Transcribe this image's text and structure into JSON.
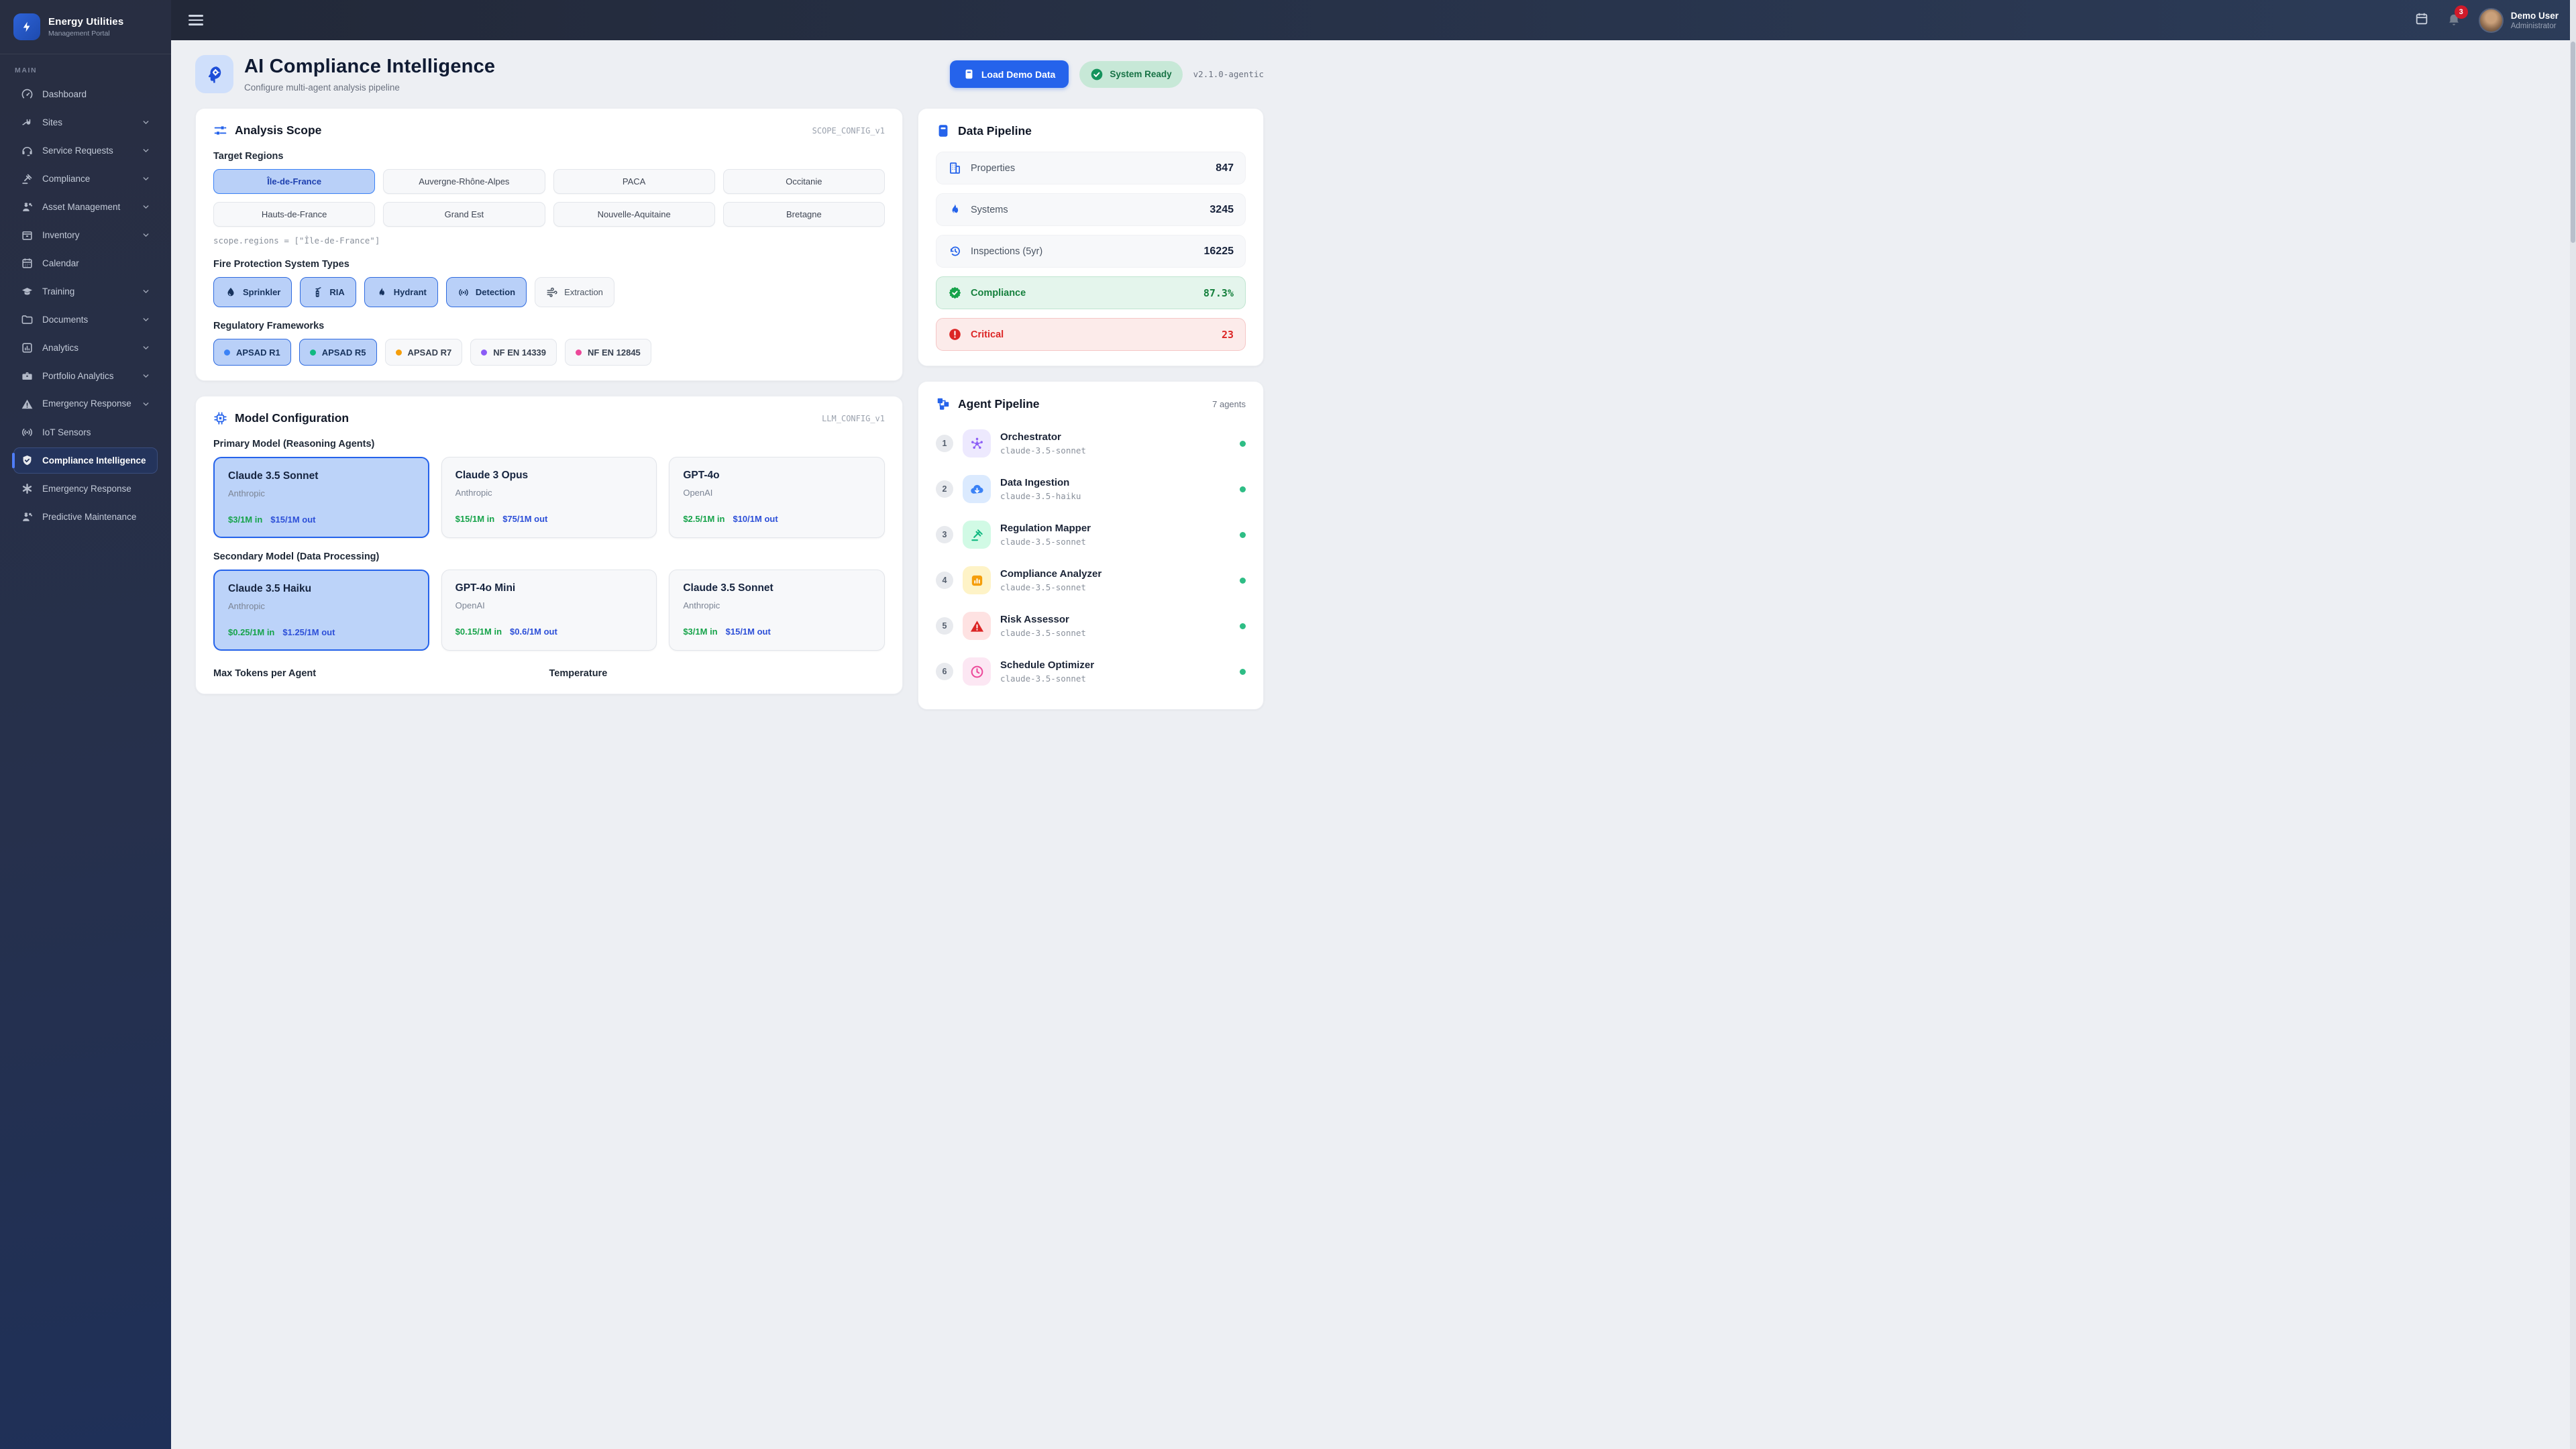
{
  "app": {
    "name": "Energy Utilities",
    "subtitle": "Management Portal"
  },
  "topbar": {
    "user_name": "Demo User",
    "user_role": "Administrator",
    "notification_count": "3"
  },
  "sidebar": {
    "section_label": "MAIN",
    "items": [
      {
        "label": "Dashboard"
      },
      {
        "label": "Sites"
      },
      {
        "label": "Service Requests"
      },
      {
        "label": "Compliance"
      },
      {
        "label": "Asset Management"
      },
      {
        "label": "Inventory"
      },
      {
        "label": "Calendar"
      },
      {
        "label": "Training"
      },
      {
        "label": "Documents"
      },
      {
        "label": "Analytics"
      },
      {
        "label": "Portfolio Analytics"
      },
      {
        "label": "Emergency Response"
      },
      {
        "label": "IoT Sensors"
      },
      {
        "label": "Compliance Intelligence"
      },
      {
        "label": "Emergency Response"
      },
      {
        "label": "Predictive Maintenance"
      }
    ]
  },
  "header": {
    "title": "AI Compliance Intelligence",
    "subtitle": "Configure multi-agent analysis pipeline",
    "load_demo_label": "Load Demo Data",
    "status_label": "System Ready",
    "version": "v2.1.0-agentic"
  },
  "analysis_scope": {
    "title": "Analysis Scope",
    "config_tag": "SCOPE_CONFIG_v1",
    "regions_label": "Target Regions",
    "regions": [
      {
        "name": "Île-de-France"
      },
      {
        "name": "Auvergne-Rhône-Alpes"
      },
      {
        "name": "PACA"
      },
      {
        "name": "Occitanie"
      },
      {
        "name": "Hauts-de-France"
      },
      {
        "name": "Grand Est"
      },
      {
        "name": "Nouvelle-Aquitaine"
      },
      {
        "name": "Bretagne"
      }
    ],
    "code_line": "scope.regions = [\"Île-de-France\"]",
    "systems_label": "Fire Protection System Types",
    "systems": [
      {
        "label": "Sprinkler"
      },
      {
        "label": "RIA"
      },
      {
        "label": "Hydrant"
      },
      {
        "label": "Detection"
      },
      {
        "label": "Extraction"
      }
    ],
    "frameworks_label": "Regulatory Frameworks",
    "frameworks": [
      {
        "label": "APSAD R1",
        "dot_color": "#3b82f6"
      },
      {
        "label": "APSAD R5",
        "dot_color": "#10b981"
      },
      {
        "label": "APSAD R7",
        "dot_color": "#f59e0b"
      },
      {
        "label": "NF EN 14339",
        "dot_color": "#8b5cf6"
      },
      {
        "label": "NF EN 12845",
        "dot_color": "#ec4899"
      }
    ]
  },
  "model_config": {
    "title": "Model Configuration",
    "config_tag": "LLM_CONFIG_v1",
    "primary_label": "Primary Model (Reasoning Agents)",
    "secondary_label": "Secondary Model (Data Processing)",
    "primary": [
      {
        "name": "Claude 3.5 Sonnet",
        "provider": "Anthropic",
        "price_in": "$3/1M in",
        "price_out": "$15/1M out"
      },
      {
        "name": "Claude 3 Opus",
        "provider": "Anthropic",
        "price_in": "$15/1M in",
        "price_out": "$75/1M out"
      },
      {
        "name": "GPT-4o",
        "provider": "OpenAI",
        "price_in": "$2.5/1M in",
        "price_out": "$10/1M out"
      }
    ],
    "secondary": [
      {
        "name": "Claude 3.5 Haiku",
        "provider": "Anthropic",
        "price_in": "$0.25/1M in",
        "price_out": "$1.25/1M out"
      },
      {
        "name": "GPT-4o Mini",
        "provider": "OpenAI",
        "price_in": "$0.15/1M in",
        "price_out": "$0.6/1M out"
      },
      {
        "name": "Claude 3.5 Sonnet",
        "provider": "Anthropic",
        "price_in": "$3/1M in",
        "price_out": "$15/1M out"
      }
    ],
    "max_tokens_label": "Max Tokens per Agent",
    "temperature_label": "Temperature"
  },
  "data_pipeline": {
    "title": "Data Pipeline",
    "rows": [
      {
        "label": "Properties",
        "value": "847"
      },
      {
        "label": "Systems",
        "value": "3245"
      },
      {
        "label": "Inspections (5yr)",
        "value": "16225"
      },
      {
        "label": "Compliance",
        "value": "87.3%"
      },
      {
        "label": "Critical",
        "value": "23"
      }
    ]
  },
  "agent_pipeline": {
    "title": "Agent Pipeline",
    "count_label": "7 agents",
    "agents": [
      {
        "num": "1",
        "name": "Orchestrator",
        "model": "claude-3.5-sonnet"
      },
      {
        "num": "2",
        "name": "Data Ingestion",
        "model": "claude-3.5-haiku"
      },
      {
        "num": "3",
        "name": "Regulation Mapper",
        "model": "claude-3.5-sonnet"
      },
      {
        "num": "4",
        "name": "Compliance Analyzer",
        "model": "claude-3.5-sonnet"
      },
      {
        "num": "5",
        "name": "Risk Assessor",
        "model": "claude-3.5-sonnet"
      },
      {
        "num": "6",
        "name": "Schedule Optimizer",
        "model": "claude-3.5-sonnet"
      }
    ]
  }
}
